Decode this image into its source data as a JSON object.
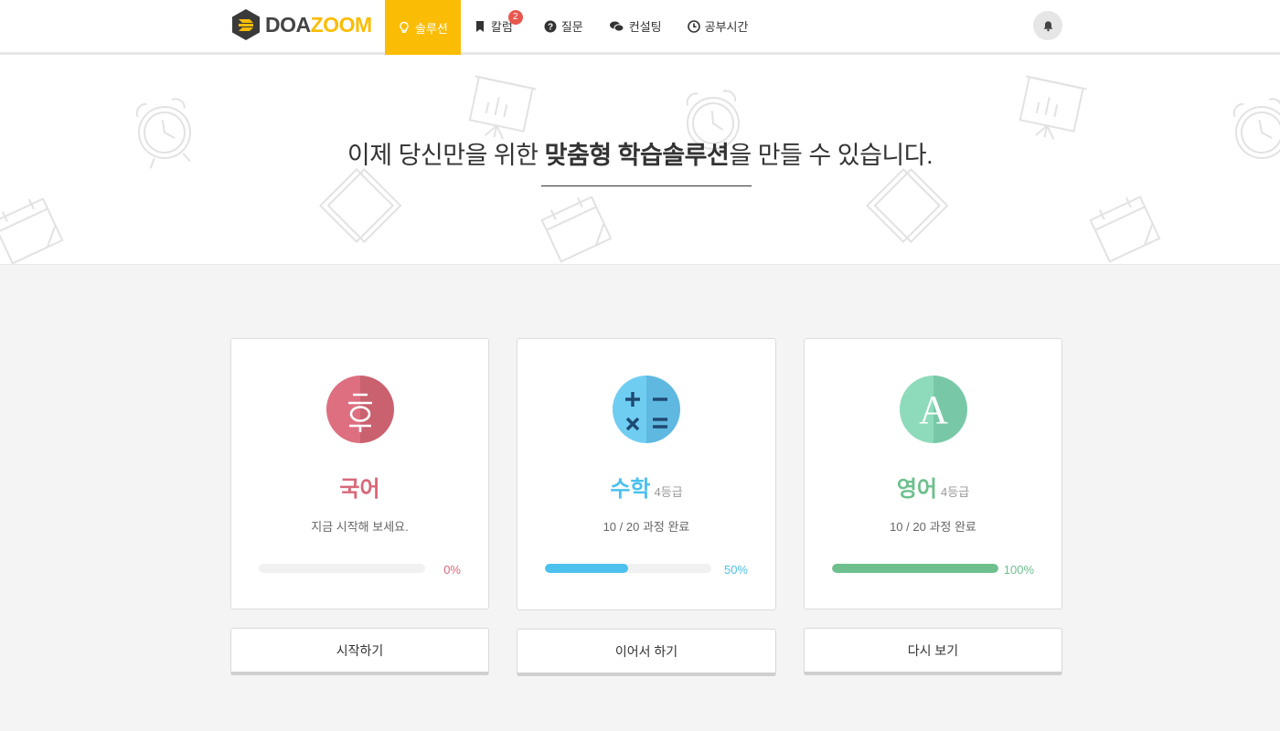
{
  "logo": {
    "text_a": "DOA",
    "text_b": "ZOOM"
  },
  "nav": {
    "items": [
      {
        "label": "솔루션",
        "icon": "lightbulb-icon",
        "active": true
      },
      {
        "label": "칼럼",
        "icon": "bookmark-icon",
        "badge": "2"
      },
      {
        "label": "질문",
        "icon": "question-circle-icon"
      },
      {
        "label": "컨설팅",
        "icon": "chat-bubbles-icon"
      },
      {
        "label": "공부시간",
        "icon": "clock-icon"
      }
    ],
    "notification_icon": "bell-icon"
  },
  "hero": {
    "title_pre": "이제 당신만을 위한 ",
    "title_bold": "맞춤형 학습솔루션",
    "title_post": "을 만들 수 있습니다."
  },
  "cards": [
    {
      "subject": "국어",
      "grade": "",
      "icon_glyph": "ㅎ",
      "desc": "지금 시작해 보세요.",
      "progress": 0,
      "percent_label": "0%",
      "color": "#d9687a",
      "button": "시작하기"
    },
    {
      "subject": "수학",
      "grade": "4등급",
      "icon_glyph": "calculator",
      "desc": "10 / 20 과정 완료",
      "progress": 0.5,
      "percent_label": "50%",
      "color": "#4cc1ee",
      "button": "이어서 하기"
    },
    {
      "subject": "영어",
      "grade": "4등급",
      "icon_glyph": "A",
      "desc": "10 / 20 과정 완료",
      "progress": 1.0,
      "percent_label": "100%",
      "color": "#6dc08e",
      "button": "다시 보기"
    }
  ]
}
